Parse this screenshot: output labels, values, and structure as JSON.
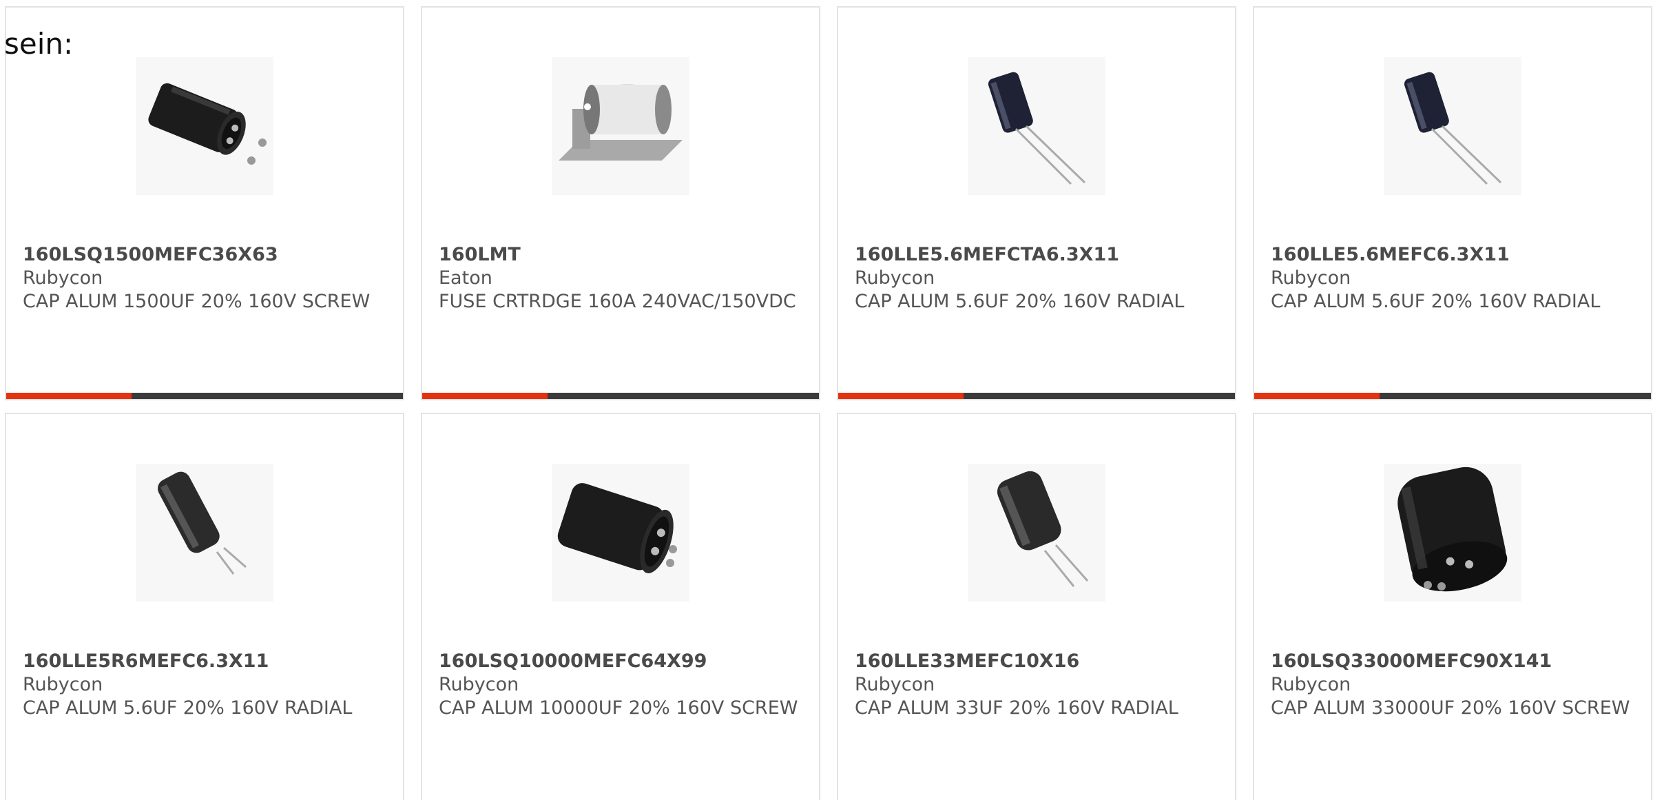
{
  "intro_text": "sein:",
  "colors": {
    "accent": "#e5330f",
    "bar": "#3a3a3a",
    "border": "#e3e3e3",
    "text": "#555555"
  },
  "products": [
    {
      "part": "160LSQ1500MEFC36X63",
      "manufacturer": "Rubycon",
      "description": "CAP ALUM 1500UF 20% 160V SCREW",
      "image_icon": "screw-capacitor-icon"
    },
    {
      "part": "160LMT",
      "manufacturer": "Eaton",
      "description": "FUSE CRTRDGE 160A 240VAC/150VDC",
      "image_icon": "fuse-cartridge-icon"
    },
    {
      "part": "160LLE5.6MEFCTA6.3X11",
      "manufacturer": "Rubycon",
      "description": "CAP ALUM 5.6UF 20% 160V RADIAL",
      "image_icon": "radial-capacitor-icon"
    },
    {
      "part": "160LLE5.6MEFC6.3X11",
      "manufacturer": "Rubycon",
      "description": "CAP ALUM 5.6UF 20% 160V RADIAL",
      "image_icon": "radial-capacitor-icon"
    },
    {
      "part": "160LLE5R6MEFC6.3X11",
      "manufacturer": "Rubycon",
      "description": "CAP ALUM 5.6UF 20% 160V RADIAL",
      "image_icon": "radial-capacitor-icon"
    },
    {
      "part": "160LSQ10000MEFC64X99",
      "manufacturer": "Rubycon",
      "description": "CAP ALUM 10000UF 20% 160V SCREW",
      "image_icon": "screw-capacitor-icon"
    },
    {
      "part": "160LLE33MEFC10X16",
      "manufacturer": "Rubycon",
      "description": "CAP ALUM 33UF 20% 160V RADIAL",
      "image_icon": "radial-capacitor-icon"
    },
    {
      "part": "160LSQ33000MEFC90X141",
      "manufacturer": "Rubycon",
      "description": "CAP ALUM 33000UF 20% 160V SCREW",
      "image_icon": "screw-capacitor-icon"
    }
  ]
}
